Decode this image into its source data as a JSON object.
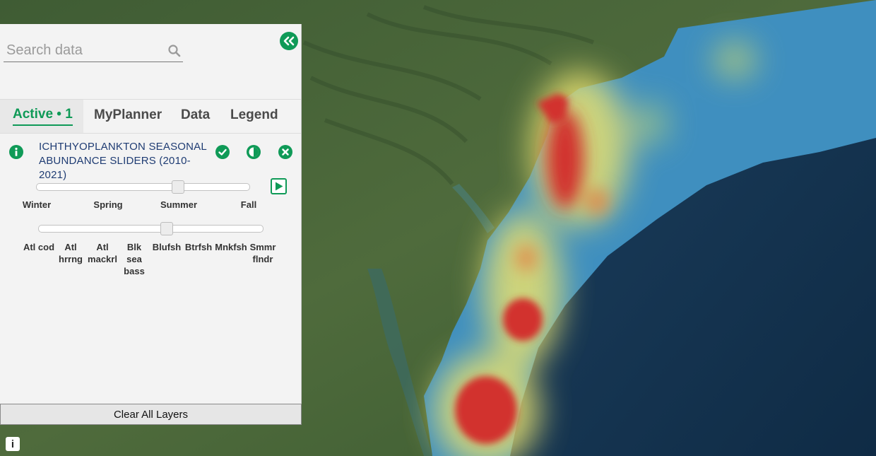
{
  "search": {
    "placeholder": "Search data"
  },
  "tabs": [
    {
      "label": "Active • 1",
      "active": true
    },
    {
      "label": "MyPlanner",
      "active": false
    },
    {
      "label": "Data",
      "active": false
    },
    {
      "label": "Legend",
      "active": false
    }
  ],
  "layer": {
    "title_line1": "ICHTHYOPLANKTON SEASONAL",
    "title_line2": "ABUNDANCE SLIDERS (2010-2021)",
    "icons": [
      "info-icon",
      "check-circle-icon",
      "contrast-icon",
      "close-circle-icon"
    ]
  },
  "season_slider": {
    "labels": [
      "Winter",
      "Spring",
      "Summer",
      "Fall"
    ],
    "selected": "Summer"
  },
  "species_slider": {
    "labels": [
      "Atl cod",
      "Atl hrrng",
      "Atl mackrl",
      "Blk sea bass",
      "Blufsh",
      "Btrfsh",
      "Mnkfsh",
      "Smmr flndr"
    ],
    "selected": "Blufsh"
  },
  "buttons": {
    "clear_all": "Clear All Layers",
    "map_info": "i"
  },
  "colors": {
    "accent": "#0f9a57",
    "layer_title": "#1f3c73",
    "heat_high": "#d2322d",
    "heat_mid": "#e6e070",
    "heat_low": "#43a3d2"
  }
}
